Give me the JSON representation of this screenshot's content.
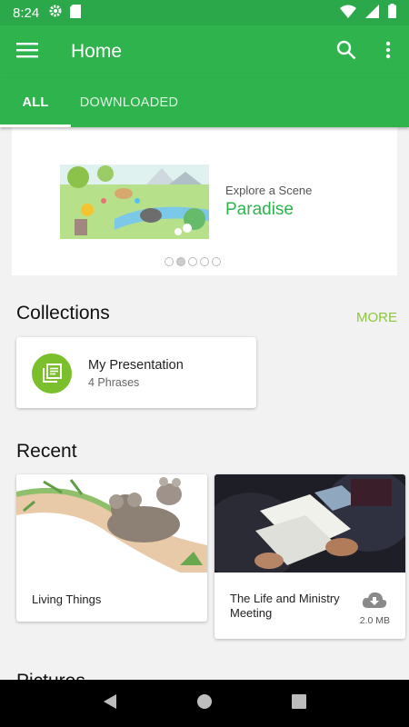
{
  "status_bar": {
    "time": "8:24",
    "icons": [
      "gear-icon",
      "sd-card-icon",
      "wifi-icon",
      "signal-icon",
      "battery-icon"
    ]
  },
  "app_bar": {
    "title": "Home",
    "icons": [
      "menu-icon",
      "search-icon",
      "overflow-menu-icon"
    ]
  },
  "tabs": [
    {
      "label": "ALL",
      "selected": true
    },
    {
      "label": "DOWNLOADED",
      "selected": false
    }
  ],
  "scene": {
    "subtitle": "Explore a Scene",
    "title": "Paradise",
    "carousel_index": 2,
    "carousel_count": 5
  },
  "collections": {
    "title": "Collections",
    "more_label": "MORE",
    "items": [
      {
        "title": "My Presentation",
        "subtitle": "4 Phrases",
        "icon": "presentation-icon"
      }
    ]
  },
  "recent": {
    "title": "Recent",
    "items": [
      {
        "title": "Living Things"
      },
      {
        "title": "The Life and Ministry Meeting",
        "size": "2.0 MB",
        "icon": "cloud-download-icon"
      }
    ]
  },
  "next_section": {
    "title": "Pictures"
  },
  "colors": {
    "primary": "#2eb34d",
    "accent": "#8cc63f",
    "status_bar": "#2ba84a"
  }
}
